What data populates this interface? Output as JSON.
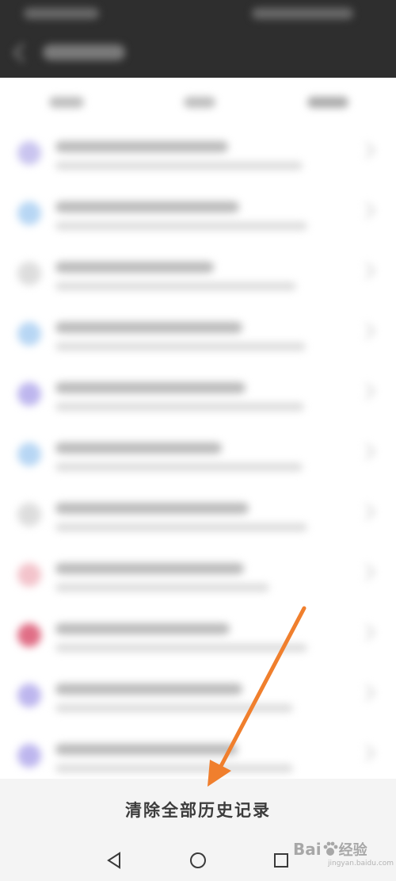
{
  "actions": {
    "clear_history_label": "清除全部历史记录"
  },
  "watermark": {
    "brand_text": "Bai",
    "brand_text_2": "经验",
    "url": "jingyan.baidu.com"
  },
  "navbar": {
    "icons": [
      "back-triangle-icon",
      "home-circle-icon",
      "recents-square-icon"
    ]
  },
  "colors": {
    "topbar": "#2e2e2e",
    "arrow": "#f07f2d",
    "list_background": "#ffffff"
  },
  "list": {
    "item_count": 11,
    "icon_colors": [
      "#c9c4ef",
      "#b7d6f4",
      "#dddddd",
      "#b7d6f4",
      "#bdb6ee",
      "#b7d6f4",
      "#dddddd",
      "#f3c3cb",
      "#e06e86",
      "#bdb6ee",
      "#bdb6ee"
    ],
    "note": "list contents are blurred in the original"
  }
}
